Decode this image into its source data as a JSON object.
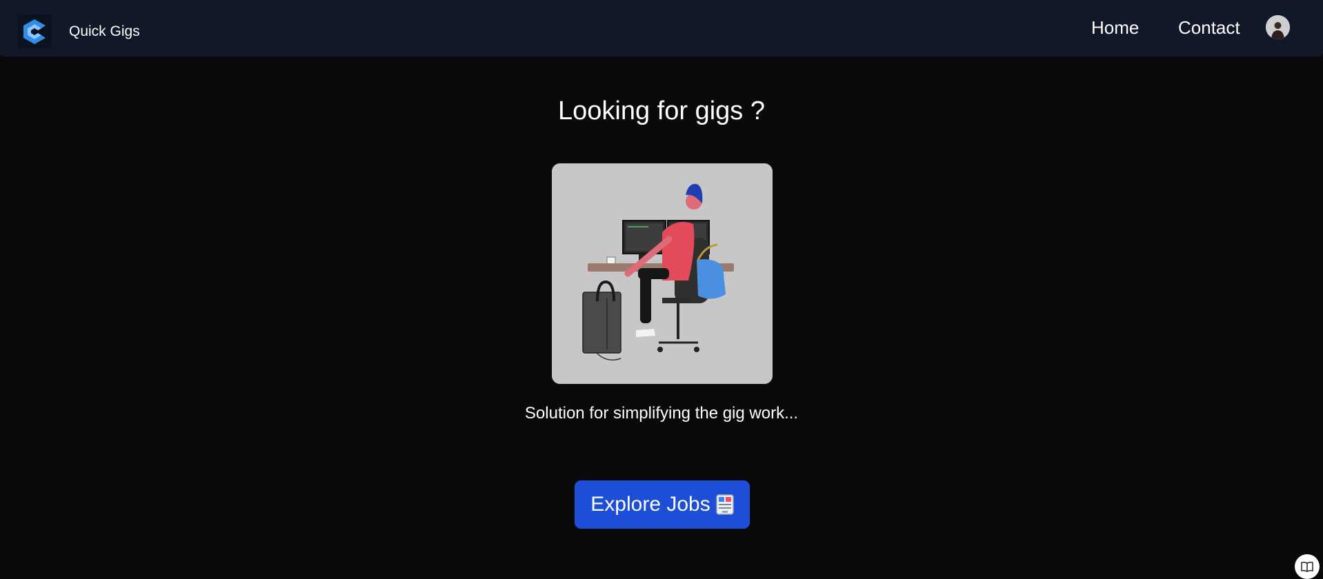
{
  "navbar": {
    "brand": "Quick Gigs",
    "links": [
      {
        "label": "Home"
      },
      {
        "label": "Contact"
      }
    ],
    "logo_icon": "quick-gigs-logo-icon",
    "avatar_icon": "user-avatar-icon"
  },
  "hero": {
    "headline": "Looking for gigs ?",
    "illustration": "person-at-desk-illustration",
    "tagline": "Solution for simplifying the gig work..."
  },
  "cta": {
    "label": "Explore Jobs",
    "icon": "job-board-icon"
  },
  "corner_button": {
    "icon": "open-book-icon"
  },
  "colors": {
    "background": "#0a0a0a",
    "navbar": "#111827",
    "accent": "#1d4ed8",
    "card": "#c7c7c7"
  }
}
